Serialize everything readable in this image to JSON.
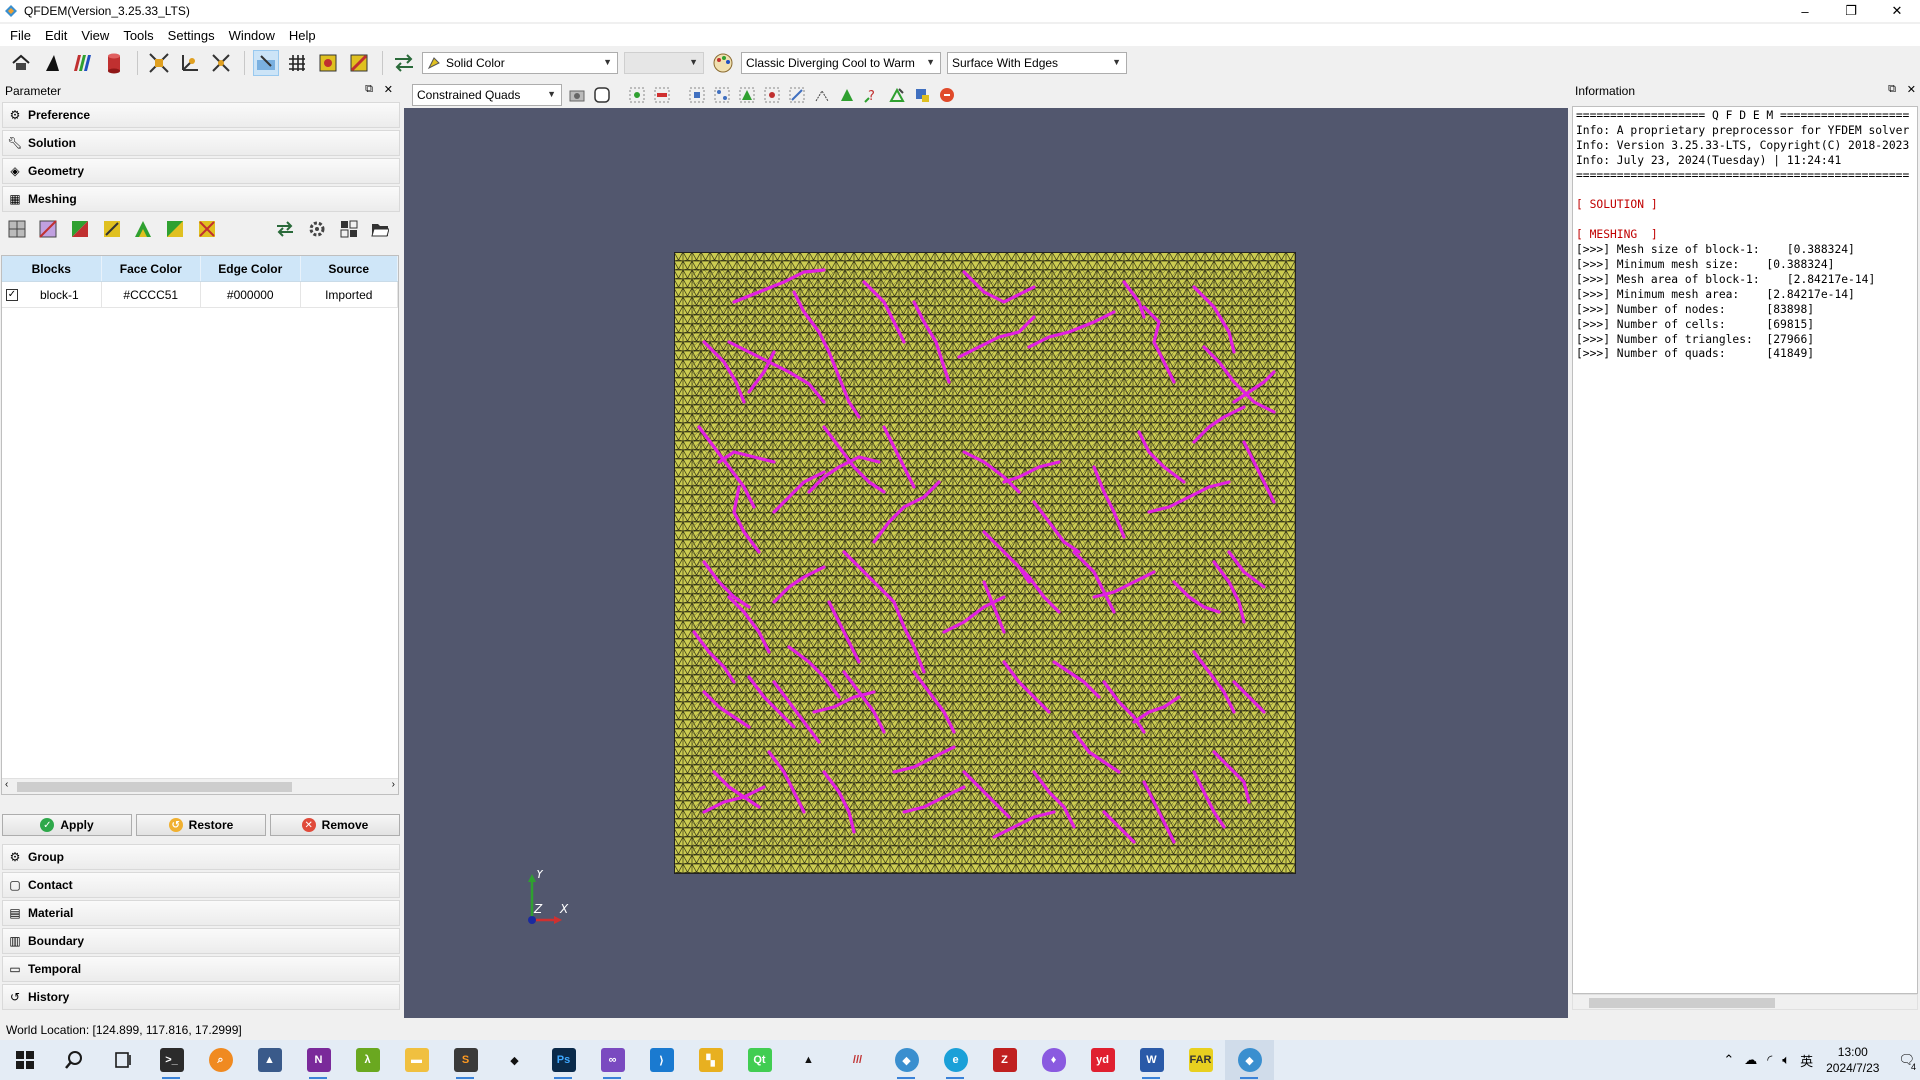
{
  "window": {
    "title": "QFDEM(Version_3.25.33_LTS)",
    "controls": [
      "–",
      "❐",
      "✕"
    ]
  },
  "menu": [
    "File",
    "Edit",
    "View",
    "Tools",
    "Settings",
    "Window",
    "Help"
  ],
  "toolbar": {
    "color_mode": "Solid Color",
    "color_map": "Classic Diverging Cool to Warm",
    "representation": "Surface With Edges",
    "icons": [
      "home-icon",
      "triangle-icon",
      "bars-icon",
      "cylinder-icon",
      "fit-icon",
      "axes-icon",
      "reset-axes-icon",
      "pick-icon",
      "grid-icon",
      "image-icon",
      "flag-icon",
      "swap-icon",
      "palette-icon"
    ]
  },
  "parameter_panel": {
    "title": "Parameter",
    "sections_top": [
      "Preference",
      "Solution",
      "Geometry",
      "Meshing"
    ],
    "table": {
      "headers": [
        "Blocks",
        "Face Color",
        "Edge Color",
        "Source"
      ],
      "rows": [
        {
          "checked": true,
          "check_glyph": "✓",
          "block": "block-1",
          "face_color": "#CCCC51",
          "edge_color": "#000000",
          "source": "Imported"
        }
      ]
    },
    "buttons": {
      "apply": "Apply",
      "restore": "Restore",
      "remove": "Remove"
    },
    "sections_bottom": [
      "Group",
      "Contact",
      "Material",
      "Boundary",
      "Temporal",
      "History"
    ]
  },
  "viewport": {
    "mesh_type": "Constrained Quads",
    "background": "#52576e",
    "mesh_face_color": "#CCCC51",
    "crack_color": "#e020e0",
    "axes": {
      "y": "Y",
      "z": "Z",
      "x": "X"
    }
  },
  "information_panel": {
    "title": "Information",
    "lines": [
      {
        "text": "=================== Q F D E M ===================",
        "red": false
      },
      {
        "text": "Info: A proprietary preprocessor for YFDEM solver",
        "red": false
      },
      {
        "text": "Info: Version 3.25.33-LTS, Copyright(C) 2018-2023",
        "red": false
      },
      {
        "text": "Info: July 23, 2024(Tuesday) | 11:24:41",
        "red": false
      },
      {
        "text": "=================================================",
        "red": false
      },
      {
        "text": "",
        "red": false
      },
      {
        "text": "[ SOLUTION ]",
        "red": true
      },
      {
        "text": "",
        "red": false
      },
      {
        "text": "[ MESHING  ]",
        "red": true
      },
      {
        "text": "[>>>] Mesh size of block-1:    [0.388324]",
        "red": false
      },
      {
        "text": "[>>>] Minimum mesh size:    [0.388324]",
        "red": false
      },
      {
        "text": "[>>>] Mesh area of block-1:    [2.84217e-14]",
        "red": false
      },
      {
        "text": "[>>>] Minimum mesh area:    [2.84217e-14]",
        "red": false
      },
      {
        "text": "[>>>] Number of nodes:      [83898]",
        "red": false
      },
      {
        "text": "[>>>] Number of cells:      [69815]",
        "red": false
      },
      {
        "text": "[>>>] Number of triangles:  [27966]",
        "red": false
      },
      {
        "text": "[>>>] Number of quads:      [41849]",
        "red": false
      }
    ]
  },
  "status": {
    "world_location": "World Location: [124.899, 117.816, 17.2999]"
  },
  "taskbar": {
    "apps": [
      "start",
      "search",
      "task-view",
      "terminal",
      "search-tool",
      "cat",
      "onenote",
      "lambda",
      "folder",
      "sublime",
      "inkscape",
      "photoshop",
      "visual-studio",
      "vscode",
      "tiles",
      "qt-creator",
      "gmsh",
      "matlab",
      "qfdem-alt",
      "edge",
      "zip",
      "diamond",
      "youdao",
      "word",
      "far",
      "qfdem"
    ],
    "tray": {
      "ime": "英",
      "time": "13:00",
      "date": "2024/7/23",
      "notifications": "4"
    }
  }
}
